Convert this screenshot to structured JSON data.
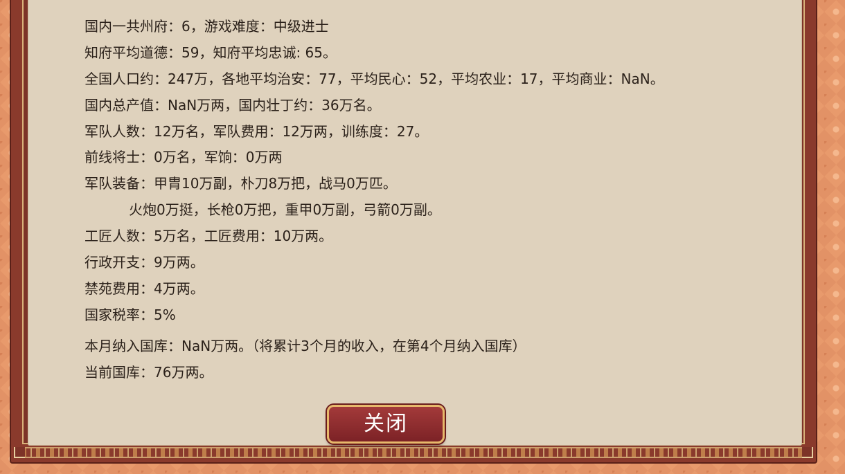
{
  "report": {
    "lines": [
      "国内一共州府：6，游戏难度：中级进士",
      "知府平均道德：59，知府平均忠诚: 65。",
      "全国人口约：247万，各地平均治安：77，平均民心：52，平均农业：17，平均商业：NaN。",
      "国内总产值：NaN万两，国内壮丁约：36万名。",
      "军队人数：12万名，军队费用：12万两，训练度：27。",
      "前线将士：0万名，军饷：0万两",
      "军队装备：甲胄10万副，朴刀8万把，战马0万匹。",
      "火炮0万挺，长枪0万把，重甲0万副，弓箭0万副。",
      "工匠人数：5万名，工匠费用：10万两。",
      "行政开支：9万两。",
      "禁苑费用：4万两。",
      "国家税率：5%"
    ],
    "treasury": [
      "本月纳入国库：NaN万两。（将累计3个月的收入，在第4个月纳入国库）",
      "当前国库：76万两。"
    ]
  },
  "close_button": {
    "label": "关闭"
  }
}
